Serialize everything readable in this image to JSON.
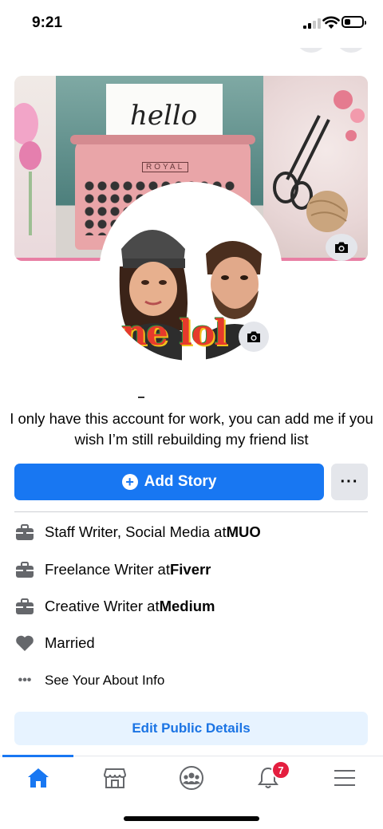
{
  "status_bar": {
    "time": "9:21"
  },
  "profile": {
    "bio": "I only have this account for work, you can add me if you wish I’m still rebuilding my friend list",
    "avatar_overlay_text": "ne lol"
  },
  "cover": {
    "typewriter_paper_text": "hello",
    "typewriter_brand": "ROYAL"
  },
  "actions": {
    "add_story_label": "Add Story",
    "more_label": "···"
  },
  "intro": {
    "items": [
      {
        "prefix": "Staff Writer, Social Media at ",
        "org": "MUO",
        "icon": "briefcase-icon"
      },
      {
        "prefix": "Freelance Writer at ",
        "org": "Fiverr",
        "icon": "briefcase-icon"
      },
      {
        "prefix": "Creative Writer at ",
        "org": "Medium",
        "icon": "briefcase-icon"
      },
      {
        "prefix": "Married",
        "org": "",
        "icon": "heart-icon"
      }
    ],
    "see_about": "See Your About Info",
    "edit_public_details": "Edit Public Details"
  },
  "nav": {
    "items": [
      "home-icon",
      "marketplace-icon",
      "groups-icon",
      "notifications-icon",
      "menu-icon"
    ],
    "notifications_badge": "7",
    "active": "home"
  },
  "colors": {
    "brand_blue": "#1877f2",
    "badge_red": "#e41e3f",
    "light_blue_button": "#e7f3ff"
  }
}
